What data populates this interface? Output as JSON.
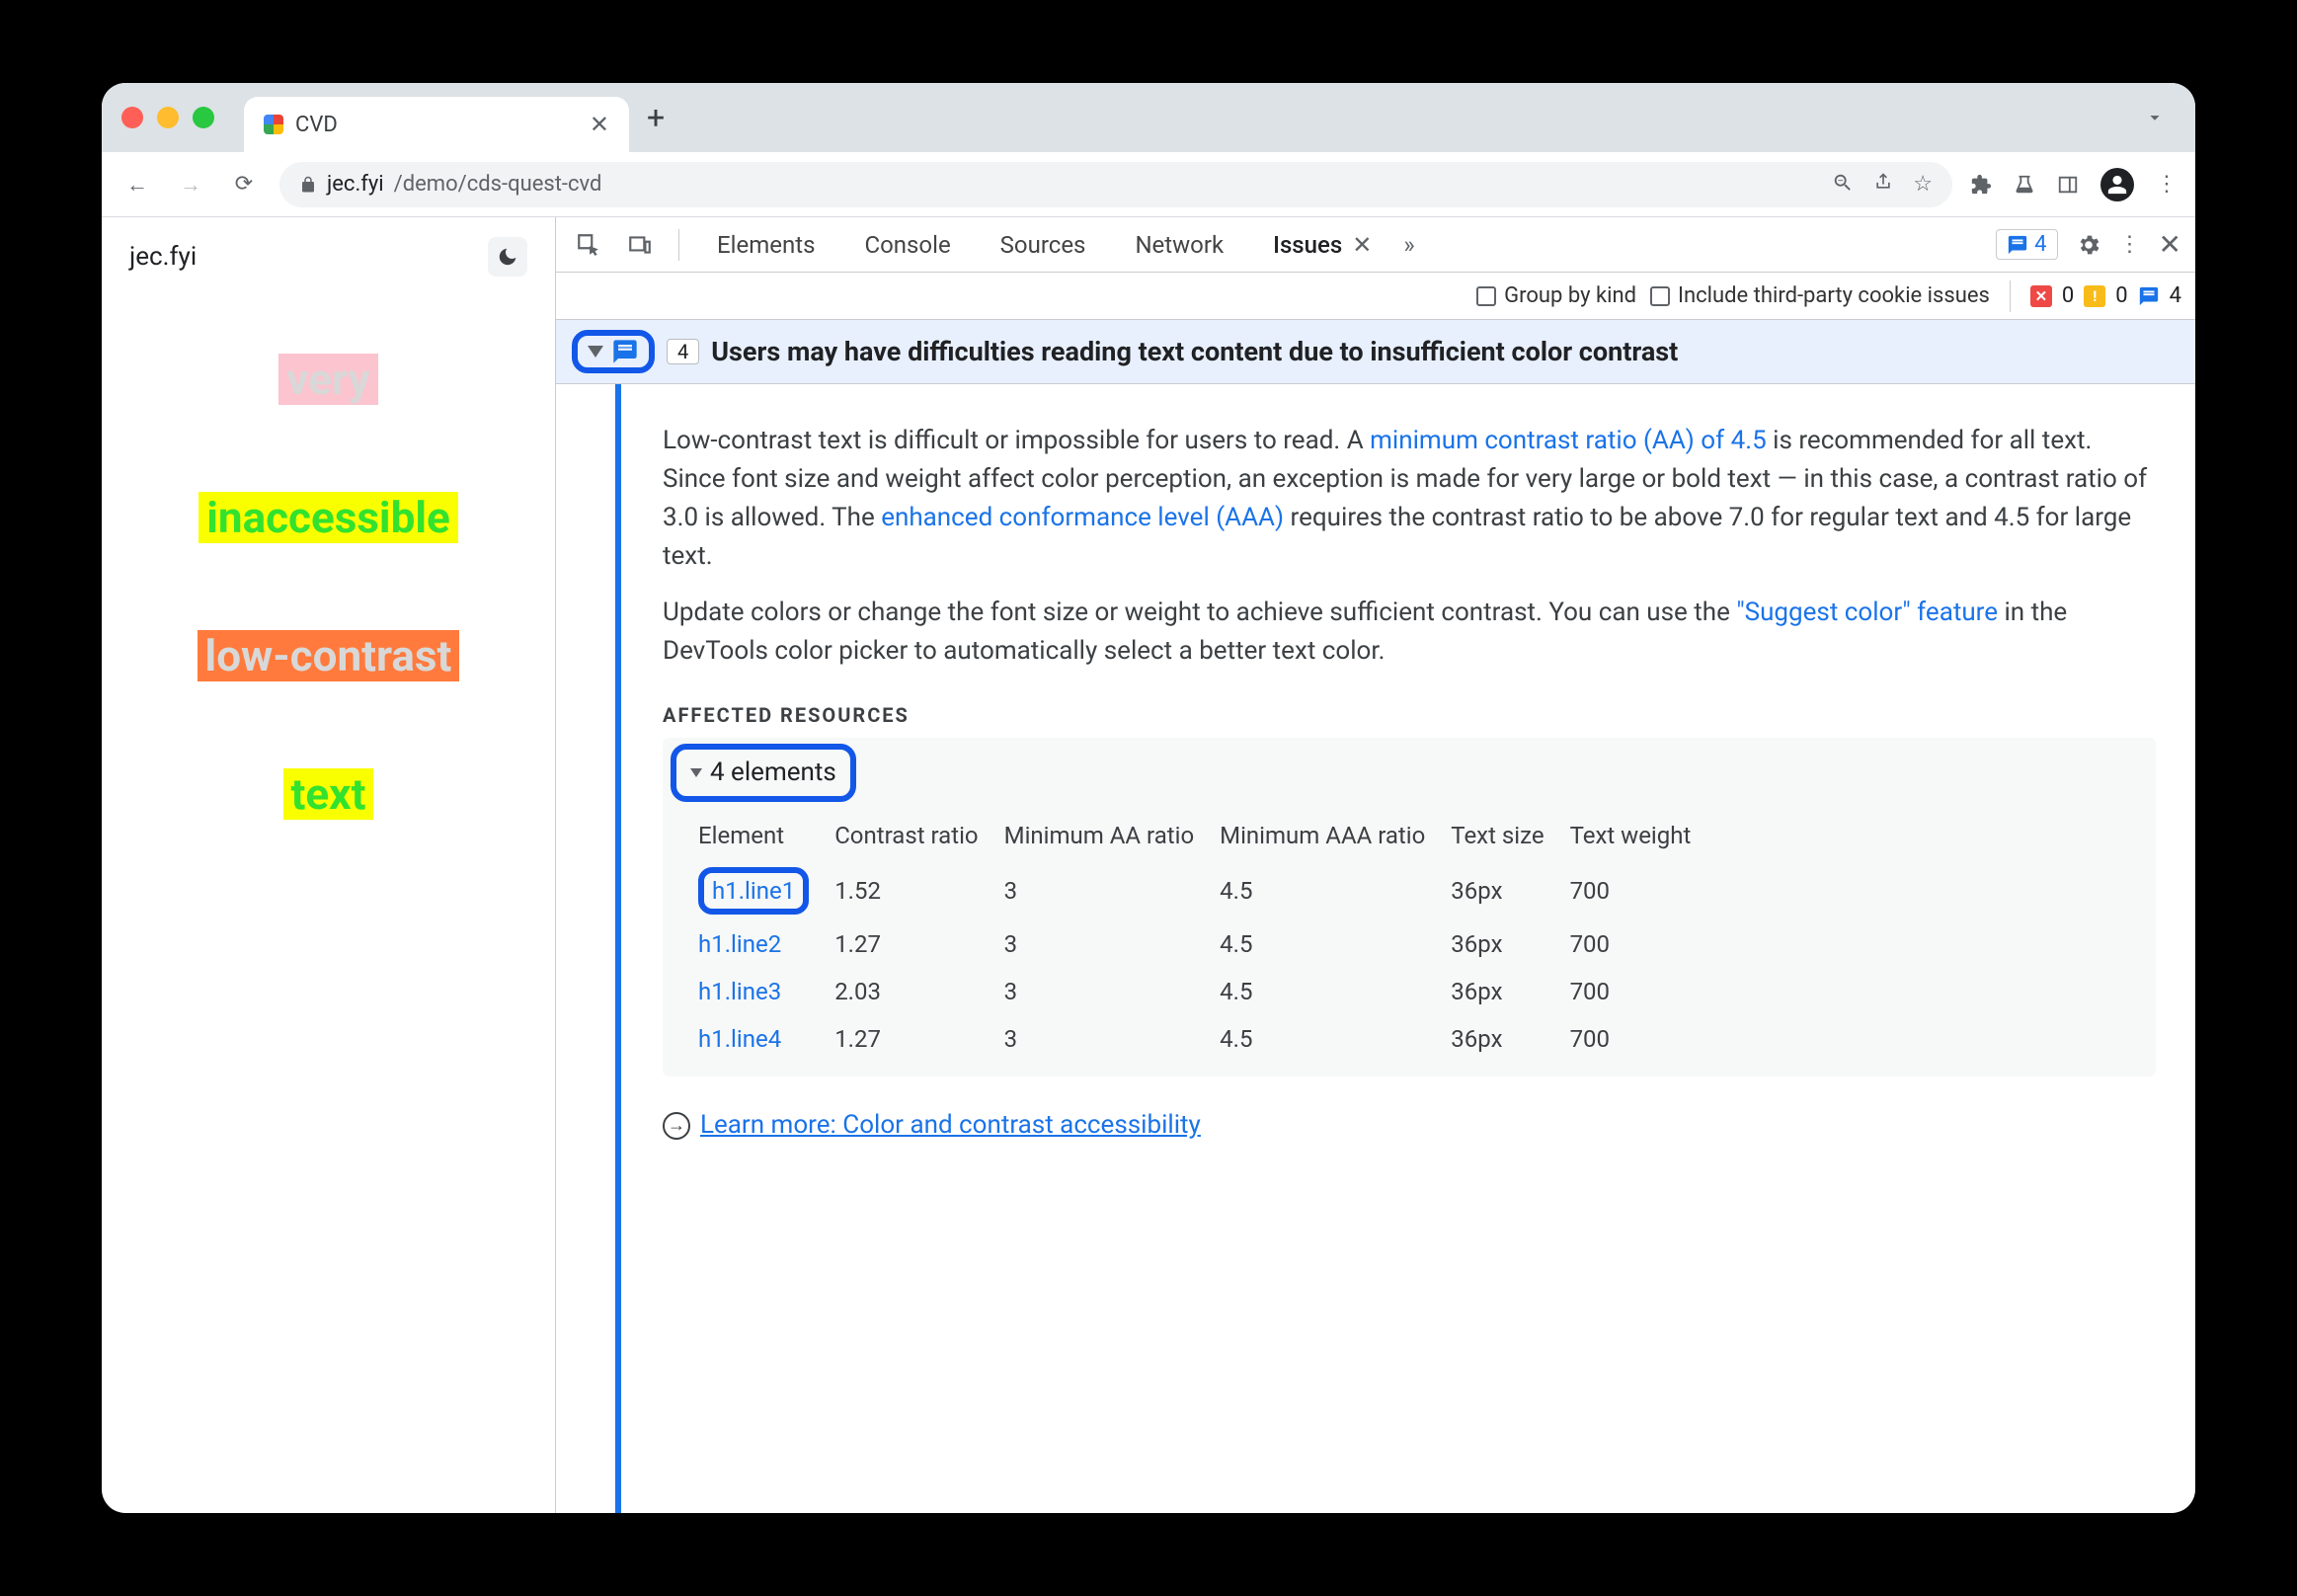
{
  "window": {
    "tab_title": "CVD",
    "url_host": "jec.fyi",
    "url_path": "/demo/cds-quest-cvd"
  },
  "page": {
    "site_label": "jec.fyi",
    "samples": [
      "very",
      "inaccessible",
      "low-contrast",
      "text"
    ]
  },
  "devtools": {
    "tabs": [
      "Elements",
      "Console",
      "Sources",
      "Network"
    ],
    "active_tab": "Issues",
    "chip_count": "4",
    "filter": {
      "group_by_kind": "Group by kind",
      "include_third_party": "Include third-party cookie issues"
    },
    "counts": {
      "errors": "0",
      "warnings": "0",
      "info": "4"
    }
  },
  "issue": {
    "count": "4",
    "title": "Users may have difficulties reading text content due to insufficient color contrast",
    "p1_a": "Low-contrast text is difficult or impossible for users to read. A ",
    "p1_link1": "minimum contrast ratio (AA) of 4.5",
    "p1_b": " is recommended for all text. Since font size and weight affect color perception, an exception is made for very large or bold text — in this case, a contrast ratio of 3.0 is allowed. The ",
    "p1_link2": "enhanced conformance level (AAA)",
    "p1_c": " requires the contrast ratio to be above 7.0 for regular text and 4.5 for large text.",
    "p2_a": "Update colors or change the font size or weight to achieve sufficient contrast. You can use the ",
    "p2_link": "\"Suggest color\" feature",
    "p2_b": " in the DevTools color picker to automatically select a better text color.",
    "affected_header": "Affected Resources",
    "elements_label": "4 elements",
    "table": {
      "headers": [
        "Element",
        "Contrast ratio",
        "Minimum AA ratio",
        "Minimum AAA ratio",
        "Text size",
        "Text weight"
      ],
      "rows": [
        {
          "el": "h1.line1",
          "cr": "1.52",
          "aa": "3",
          "aaa": "4.5",
          "size": "36px",
          "weight": "700"
        },
        {
          "el": "h1.line2",
          "cr": "1.27",
          "aa": "3",
          "aaa": "4.5",
          "size": "36px",
          "weight": "700"
        },
        {
          "el": "h1.line3",
          "cr": "2.03",
          "aa": "3",
          "aaa": "4.5",
          "size": "36px",
          "weight": "700"
        },
        {
          "el": "h1.line4",
          "cr": "1.27",
          "aa": "3",
          "aaa": "4.5",
          "size": "36px",
          "weight": "700"
        }
      ]
    },
    "learn_more": "Learn more: Color and contrast accessibility"
  }
}
